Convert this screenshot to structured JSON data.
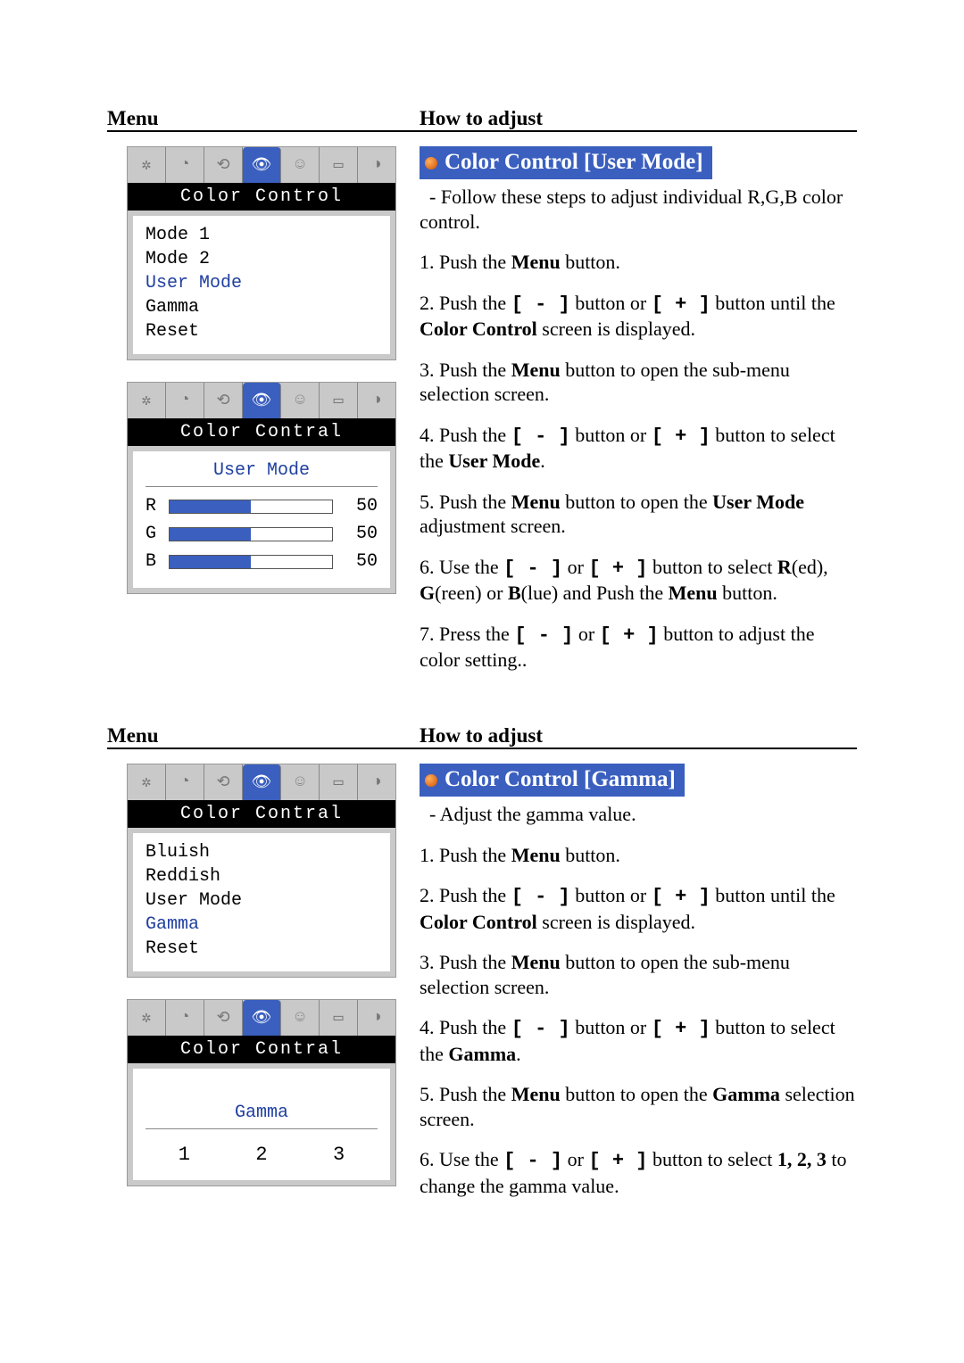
{
  "headers": {
    "menu": "Menu",
    "how": "How to adjust"
  },
  "section1": {
    "title": "Color Control [User Mode]",
    "osd1": {
      "title": "Color Control",
      "items": [
        "Mode 1",
        "Mode 2",
        "User Mode",
        "Gamma",
        "Reset"
      ],
      "highlight_index": 2
    },
    "osd2": {
      "title": "Color Contral",
      "subtitle": "User Mode",
      "rgb": [
        {
          "label": "R",
          "value": "50"
        },
        {
          "label": "G",
          "value": "50"
        },
        {
          "label": "B",
          "value": "50"
        }
      ]
    },
    "intro": "Follow these steps to adjust individual R,G,B color control.",
    "steps": [
      {
        "n": "1.",
        "pre": "Push the ",
        "b1": "Menu",
        "post": " button."
      },
      {
        "n": "2.",
        "pre": "Push the ",
        "k1": "[ - ]",
        "mid1": " button or ",
        "k2": "[ + ]",
        "mid2": " button until the ",
        "b1": "Color Control",
        "post": " screen is displayed."
      },
      {
        "n": "3.",
        "pre": "Push the ",
        "b1": "Menu",
        "post": " button to open the sub-menu selection screen."
      },
      {
        "n": "4.",
        "pre": "Push the ",
        "k1": "[ - ]",
        "mid1": " button or ",
        "k2": "[ + ]",
        "mid2": " button to select the ",
        "b1": "User Mode",
        "post": "."
      },
      {
        "n": "5.",
        "pre": "Push the ",
        "b1": "Menu",
        "mid": " button to open the ",
        "b2": "User Mode",
        "post": " adjustment screen."
      },
      {
        "n": "6.",
        "pre": "Use the ",
        "k1": "[ - ]",
        "mid1": " or ",
        "k2": "[ + ]",
        "mid2": " button to select ",
        "b1": "R",
        "mid3": "(ed), ",
        "b2": "G",
        "mid4": "(reen) or ",
        "b3": "B",
        "mid5": "(lue) and Push the ",
        "b4": "Menu",
        "post": " button."
      },
      {
        "n": "7.",
        "pre": "Press the ",
        "k1": "[ - ]",
        "mid1": " or ",
        "k2": "[ + ]",
        "post": " button to adjust the color setting.."
      }
    ]
  },
  "section2": {
    "title": "Color Control [Gamma]",
    "osd1": {
      "title": "Color Contral",
      "items": [
        "Bluish",
        "Reddish",
        "User Mode",
        "Gamma",
        "Reset"
      ],
      "highlight_index": 3
    },
    "osd2": {
      "title": "Color Contral",
      "subtitle": "Gamma",
      "options": [
        "1",
        "2",
        "3"
      ]
    },
    "intro": "Adjust the gamma value.",
    "steps": [
      {
        "n": "1.",
        "pre": "Push the ",
        "b1": "Menu",
        "post": " button."
      },
      {
        "n": "2.",
        "pre": "Push the ",
        "k1": "[ - ]",
        "mid1": " button or ",
        "k2": "[ + ]",
        "mid2": " button until the ",
        "b1": "Color Control",
        "post": " screen is displayed."
      },
      {
        "n": "3.",
        "pre": "Push the ",
        "b1": "Menu",
        "post": " button to open the sub-menu selection screen."
      },
      {
        "n": "4.",
        "pre": "Push the ",
        "k1": "[ - ]",
        "mid1": " button or ",
        "k2": "[ + ]",
        "mid2": " button to select the ",
        "b1": "Gamma",
        "post": "."
      },
      {
        "n": "5.",
        "pre": "Push the ",
        "b1": "Menu",
        "mid": " button to open the ",
        "b2": "Gamma",
        "post": " selection screen."
      },
      {
        "n": "6.",
        "pre": "Use the ",
        "k1": "[ - ]",
        "mid1": " or ",
        "k2": "[ + ]",
        "mid2": " button to select ",
        "b1": "1, 2, 3",
        "post": " to change the gamma value."
      }
    ]
  },
  "icons": [
    "✲",
    "◔",
    "⟲",
    "👁",
    "☺",
    "▭",
    "◑"
  ]
}
